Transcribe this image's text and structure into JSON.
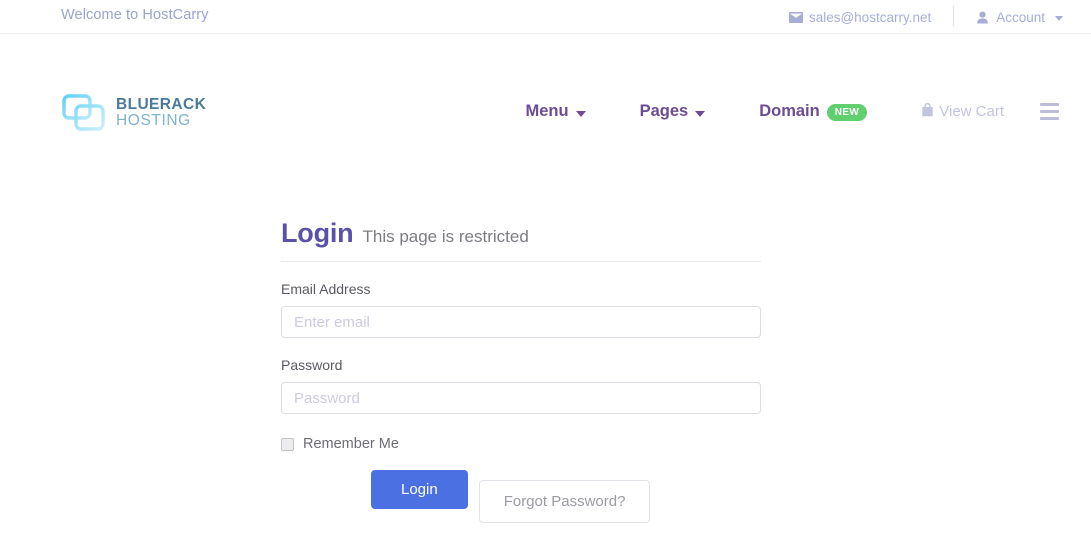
{
  "topbar": {
    "welcome": "Welcome to HostCarry",
    "email": "sales@hostcarry.net",
    "email_icon": "mail-icon",
    "account_label": "Account",
    "account_icon": "user-icon",
    "caret_icon": "chevron-down-icon"
  },
  "header": {
    "logo": {
      "icon": "bluerack-logo-icon",
      "line1": "BLUERACK",
      "line2": "HOSTING"
    },
    "nav": [
      {
        "label": "Menu",
        "caret": "chevron-down-icon",
        "badge": null
      },
      {
        "label": "Pages",
        "caret": "chevron-down-icon",
        "badge": null
      },
      {
        "label": "Domain",
        "caret": null,
        "badge": "NEW"
      }
    ],
    "cart": {
      "label": "View Cart",
      "icon": "shopping-bag-icon"
    },
    "burger_icon": "hamburger-menu-icon"
  },
  "login": {
    "title": "Login",
    "subtitle": "This page is restricted",
    "email_field": {
      "label": "Email Address",
      "value": "",
      "placeholder": "Enter email"
    },
    "password_field": {
      "label": "Password",
      "value": "",
      "placeholder": "Password"
    },
    "remember": {
      "label": "Remember Me",
      "checked": false
    },
    "submit_label": "Login",
    "forgot_label": "Forgot Password?"
  },
  "colors": {
    "nav_purple": "#6d4c94",
    "title_purple": "#5a51a8",
    "badge_green": "#5fd06d",
    "button_blue": "#4a70e2",
    "topbar_text": "#9aa3d0",
    "logo_dark": "#4a7a9b",
    "logo_light": "#7fb4cd"
  }
}
